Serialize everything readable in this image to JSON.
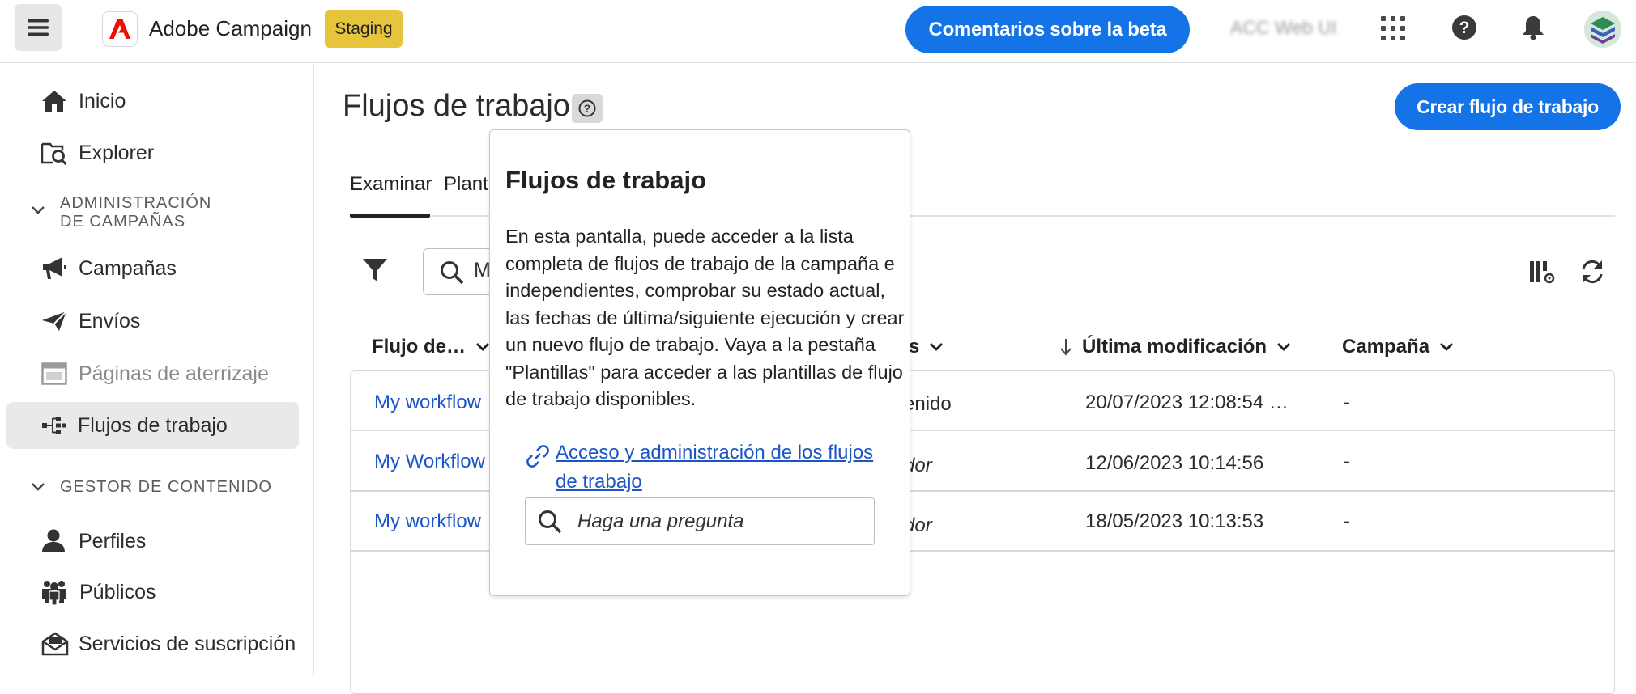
{
  "header": {
    "app_name": "Adobe Campaign",
    "environment_badge": "Staging",
    "beta_feedback_button": "Comentarios sobre la beta",
    "org_name": "ACC Web UI",
    "icons": [
      "menu-icon",
      "adobe-logo",
      "apps-grid-icon",
      "help-icon",
      "bell-icon",
      "avatar"
    ]
  },
  "sidebar": {
    "top_items": [
      {
        "label": "Inicio",
        "icon": "home-icon"
      },
      {
        "label": "Explorer",
        "icon": "explorer-icon"
      }
    ],
    "sections": [
      {
        "title": "ADMINISTRACIÓN\nDE CAMPAÑAS",
        "expanded": true,
        "items": [
          {
            "label": "Campañas",
            "icon": "megaphone-icon"
          },
          {
            "label": "Envíos",
            "icon": "send-icon"
          },
          {
            "label": "Páginas de aterrizaje",
            "icon": "landing-page-icon",
            "disabled": true
          },
          {
            "label": "Flujos de trabajo",
            "icon": "workflow-icon",
            "active": true
          }
        ]
      },
      {
        "title": "GESTOR DE CONTENIDO",
        "expanded": true,
        "items": [
          {
            "label": "Perfiles",
            "icon": "user-icon"
          },
          {
            "label": "Públicos",
            "icon": "audiences-icon"
          },
          {
            "label": "Servicios de suscripción",
            "icon": "subscription-icon"
          }
        ]
      }
    ]
  },
  "main": {
    "title": "Flujos de trabajo",
    "create_button": "Crear flujo de trabajo",
    "tabs": [
      {
        "label": "Examinar",
        "active": true
      },
      {
        "label": "Plantillas",
        "visible_text": "Plant"
      }
    ],
    "search_value": "M",
    "columns": [
      {
        "label": "Flujo de…"
      },
      {
        "label": "Estado",
        "visible_text": "s"
      },
      {
        "label": "Última modificación",
        "sorted": "desc"
      },
      {
        "label": "Campaña"
      }
    ],
    "rows": [
      {
        "name": "My workflow",
        "status": "enido",
        "status_italic": false,
        "modified": "20/07/2023 12:08:54 …",
        "campaign": "-"
      },
      {
        "name": "My Workflow",
        "status": "dor",
        "status_italic": true,
        "modified": "12/06/2023  10:14:56",
        "campaign": "-"
      },
      {
        "name": "My workflow",
        "status": "dor",
        "status_italic": true,
        "modified": "18/05/2023  10:13:53",
        "campaign": "-"
      }
    ]
  },
  "popover": {
    "title": "Flujos de trabajo",
    "body": "En esta pantalla, puede acceder a la lista completa de flujos de trabajo de la campaña e independientes, comprobar su estado actual, las fechas de última/siguiente ejecución y crear un nuevo  flujo de trabajo. Vaya a la pestaña \"Plantillas\" para acceder a las plantillas de flujo de trabajo disponibles.",
    "link_text": "Acceso y administración de los flujos de trabajo",
    "ask_placeholder": "Haga una pregunta"
  },
  "colors": {
    "accent_blue": "#1473e6",
    "link_blue": "#1a55c8",
    "badge_yellow": "#e6c43c",
    "adobe_red": "#eb1000",
    "active_nav_bg": "#e9e9e9"
  }
}
